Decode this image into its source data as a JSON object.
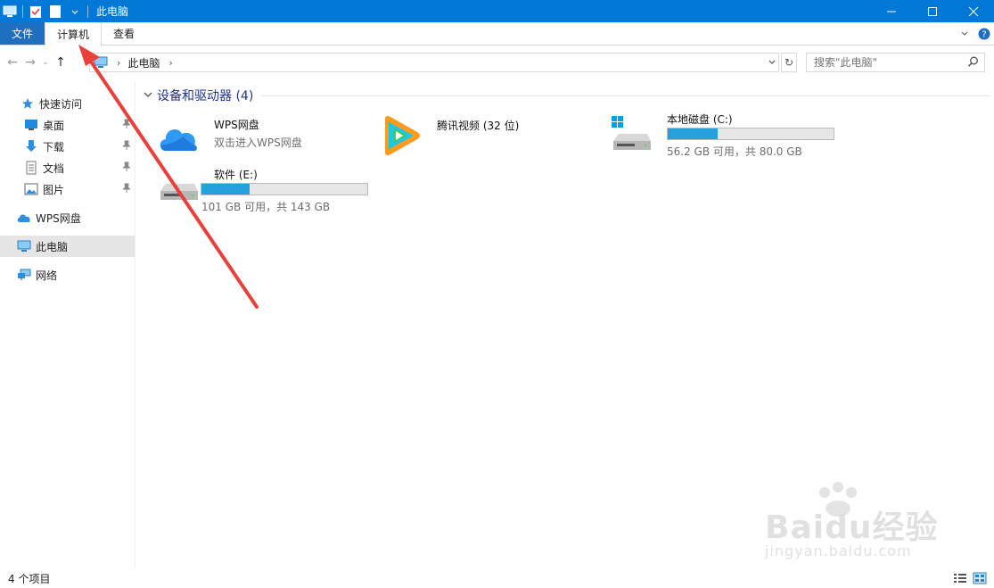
{
  "window": {
    "title": "此电脑",
    "accent": "#0078d7"
  },
  "ribbon": {
    "tabs": [
      {
        "label": "文件"
      },
      {
        "label": "计算机"
      },
      {
        "label": "查看"
      }
    ]
  },
  "address": {
    "crumb": "此电脑"
  },
  "search": {
    "placeholder": "搜索\"此电脑\""
  },
  "sidebar": {
    "items": [
      {
        "label": "快速访问",
        "icon": "star-icon"
      },
      {
        "label": "桌面",
        "icon": "desktop-icon",
        "pinned": true
      },
      {
        "label": "下载",
        "icon": "download-icon",
        "pinned": true
      },
      {
        "label": "文档",
        "icon": "document-icon",
        "pinned": true
      },
      {
        "label": "图片",
        "icon": "picture-icon",
        "pinned": true
      },
      {
        "label": "WPS网盘",
        "icon": "cloud-icon"
      },
      {
        "label": "此电脑",
        "icon": "computer-icon",
        "selected": true
      },
      {
        "label": "网络",
        "icon": "network-icon"
      }
    ]
  },
  "main": {
    "group_title": "设备和驱动器 (4)",
    "items": [
      {
        "name": "WPS网盘",
        "subtitle": "双击进入WPS网盘"
      },
      {
        "name": "腾讯视频 (32 位)"
      },
      {
        "name": "本地磁盘 (C:)",
        "free_text": "56.2 GB 可用，共 80.0 GB",
        "used_fraction": 0.3
      },
      {
        "name": "软件 (E:)",
        "free_text": "101 GB 可用，共 143 GB",
        "used_fraction": 0.29
      }
    ]
  },
  "status": {
    "item_count": "4 个项目"
  },
  "watermark": {
    "main": "Baidu经验",
    "sub": "jingyan.baidu.com"
  },
  "colors": {
    "drive_bar": "#26a0da",
    "group_title": "#1e3287",
    "annotation_arrow": "#e8403a"
  }
}
